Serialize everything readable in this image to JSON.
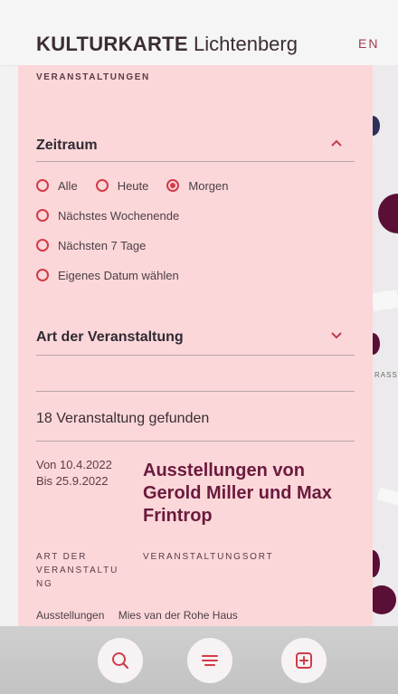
{
  "header": {
    "brand": "KULTURKARTE",
    "district": "Lichtenberg",
    "language_toggle": "EN"
  },
  "panel": {
    "section_title": "VERANSTALTUNGEN",
    "filters": {
      "zeitraum": {
        "label": "Zeitraum",
        "expanded": true,
        "options": [
          {
            "label": "Alle",
            "checked": false
          },
          {
            "label": "Heute",
            "checked": false
          },
          {
            "label": "Morgen",
            "checked": true
          },
          {
            "label": "Nächstes Wochenende",
            "checked": false
          },
          {
            "label": "Nächsten 7 Tage",
            "checked": false
          },
          {
            "label": "Eigenes Datum wählen",
            "checked": false
          }
        ]
      },
      "art": {
        "label": "Art der Veranstaltung",
        "expanded": false
      }
    },
    "result_count": "18 Veranstaltung gefunden",
    "event": {
      "date_from": "Von 10.4.2022",
      "date_to": "Bis 25.9.2022",
      "title": "Ausstellungen von Gerold Miller und Max Frintrop",
      "type_label": "ART DER VERANSTALTU NG",
      "venue_label": "VERANSTALTUNGSORT",
      "type_value_cut": "Ausstellungen",
      "venue_value_cut": "Mies van der Rohe Haus"
    }
  },
  "map": {
    "street_label": "RASS"
  },
  "dock": {
    "buttons": [
      {
        "icon": "search-icon"
      },
      {
        "icon": "menu-icon"
      },
      {
        "icon": "add-icon"
      }
    ]
  },
  "colors": {
    "panel_bg": "#fbd7d9",
    "accent_red": "#d23b48",
    "title_plum": "#6b1a3e",
    "lang_red": "#a23b4f"
  }
}
